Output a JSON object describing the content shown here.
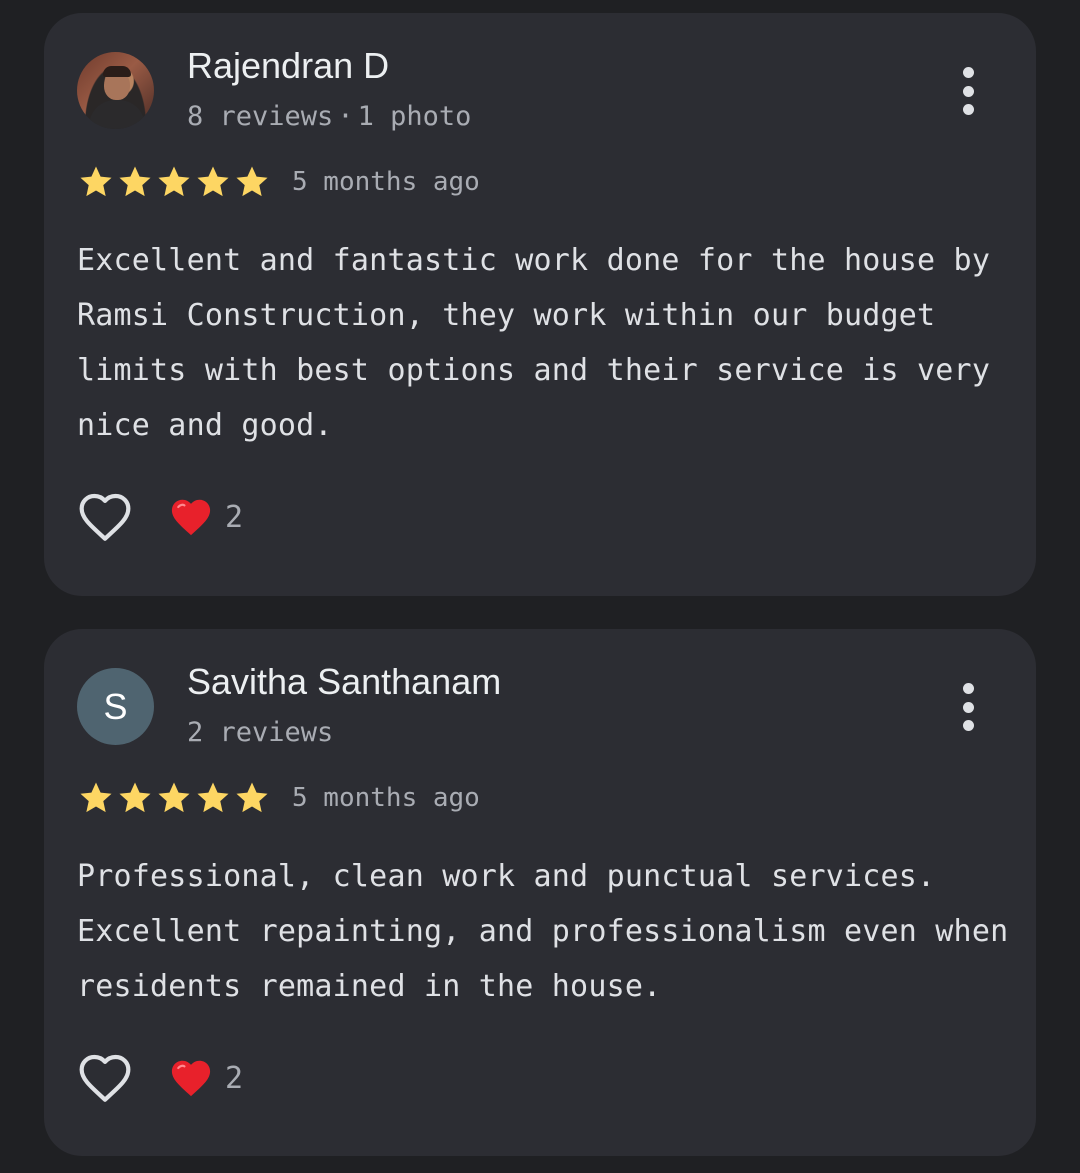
{
  "reviews": [
    {
      "name": "Rajendran D",
      "reviews_count": "8 reviews",
      "photos": "1 photo",
      "avatar_initial": "",
      "rating": 5,
      "time_ago": "5 months ago",
      "text": "Excellent and fantastic work done for the house by Ramsi Construction, they work within our budget limits with best options and their service is very nice and good.",
      "heart_count": "2"
    },
    {
      "name": "Savitha Santhanam",
      "reviews_count": "2 reviews",
      "photos": "",
      "avatar_initial": "S",
      "rating": 5,
      "time_ago": "5 months ago",
      "text": "Professional, clean work and punctual services. Excellent repainting, and professionalism even when residents remained in the house.",
      "heart_count": "2"
    }
  ],
  "icons": {
    "star": "star-icon",
    "like": "heart-outline-icon",
    "reaction": "red-heart-icon",
    "more": "more-vert-icon"
  },
  "colors": {
    "background": "#1f2023",
    "card": "#2c2d33",
    "star": "#fdd663",
    "heart": "#e8212b",
    "text": "#dfe1e5",
    "muted": "#a9acb3"
  }
}
